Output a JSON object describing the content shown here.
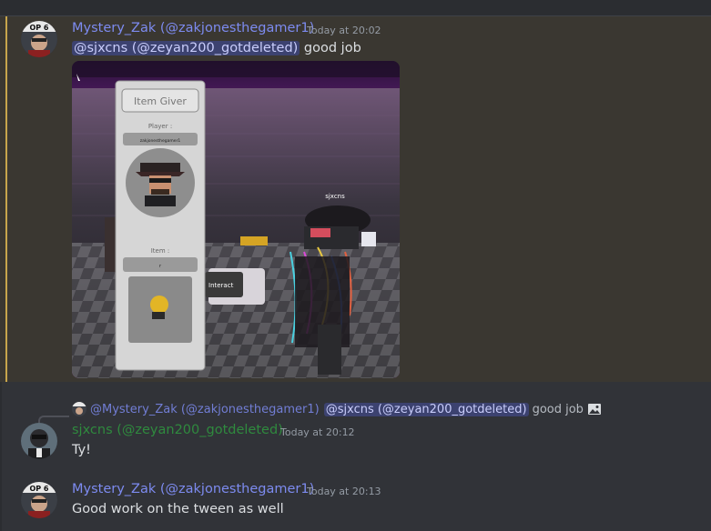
{
  "colors": {
    "background": "#313338",
    "highlight": "#3a3731",
    "highlight_bar": "#c7a54c",
    "username_blue": "#7d8bf0",
    "username_green": "#2f8a3e",
    "mention_bg": "#3c4270"
  },
  "messages": [
    {
      "author": "Mystery_Zak (@zakjonesthegamer1)",
      "timestamp": "Today at 20:02",
      "mention": "@sjxcns (@zeyan200_gotdeleted)",
      "text": " good job",
      "attachment": {
        "panel_title": "Item Giver",
        "player_label": "Player :",
        "player_name": "zakjonesthegamer1",
        "item_label": "Item :",
        "item_name": "r",
        "interact_label": "Interact",
        "overhead_name": "sjxcns"
      }
    },
    {
      "reply": {
        "author": "@Mystery_Zak (@zakjonesthegamer1)",
        "mention": "@sjxcns (@zeyan200_gotdeleted)",
        "text": "good job",
        "icon": "image-icon"
      },
      "author": "sjxcns (@zeyan200_gotdeleted)",
      "timestamp": "Today at 20:12",
      "text": "Ty!"
    },
    {
      "author": "Mystery_Zak (@zakjonesthegamer1)",
      "timestamp": "Today at 20:13",
      "text": "Good work on the tween as well"
    }
  ]
}
